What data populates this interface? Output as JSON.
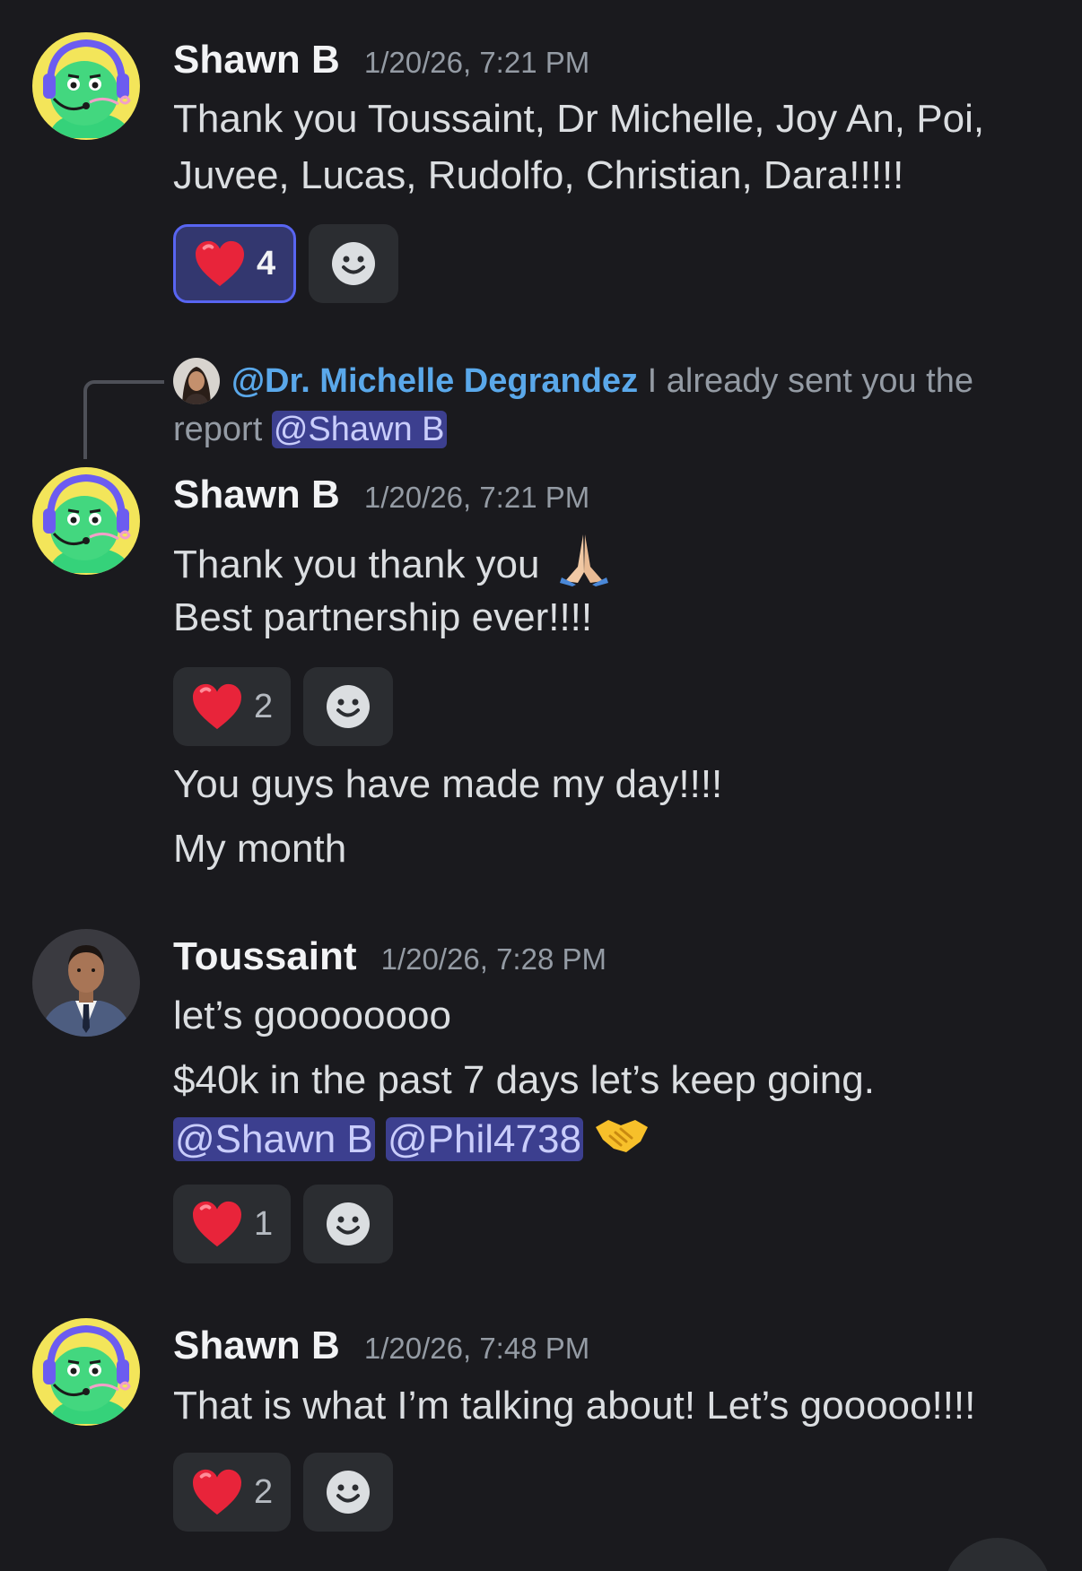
{
  "messages": [
    {
      "author": "Shawn B",
      "timestamp": "1/20/26, 7:21 PM",
      "lines": [
        "Thank you Toussaint, Dr Michelle, Joy An, Poi,",
        "Juvee, Lucas, Rudolfo, Christian, Dara!!!!!"
      ],
      "reaction": {
        "emoji": "heart",
        "count": "4",
        "active": true
      }
    },
    {
      "reply": {
        "name": "@Dr. Michelle  Degrandez",
        "text": "I already sent you the report",
        "mention": "@Shawn B"
      },
      "author": "Shawn B",
      "timestamp": "1/20/26, 7:21 PM",
      "lines": [
        "Thank you thank you",
        "Best partnership ever!!!!"
      ],
      "reaction": {
        "emoji": "heart",
        "count": "2",
        "active": false
      },
      "followups": [
        "You guys have made my day!!!!",
        "My month"
      ]
    },
    {
      "author": "Toussaint",
      "timestamp": "1/20/26, 7:28 PM",
      "lines": [
        "let’s goooooooo",
        "$40k in the past 7 days let’s keep going."
      ],
      "mentions": [
        "@Shawn B",
        "@Phil4738"
      ],
      "reaction": {
        "emoji": "heart",
        "count": "1",
        "active": false
      }
    },
    {
      "author": "Shawn B",
      "timestamp": "1/20/26, 7:48 PM",
      "lines": [
        "That is what I’m talking about! Let’s gooooo!!!!"
      ],
      "reaction": {
        "emoji": "heart",
        "count": "2",
        "active": false
      }
    }
  ],
  "icons": {
    "reaction_emoji": "heart-emoji-icon",
    "add_reaction": "smiley-face-icon",
    "praying_hands": "praying-hands-emoji-icon",
    "handshake": "handshake-emoji-icon"
  },
  "colors": {
    "background": "#1a1a1e",
    "mention_bg": "#3c3f8f",
    "reply_name": "#5aa8ea",
    "active_reaction_border": "#5865f2"
  }
}
